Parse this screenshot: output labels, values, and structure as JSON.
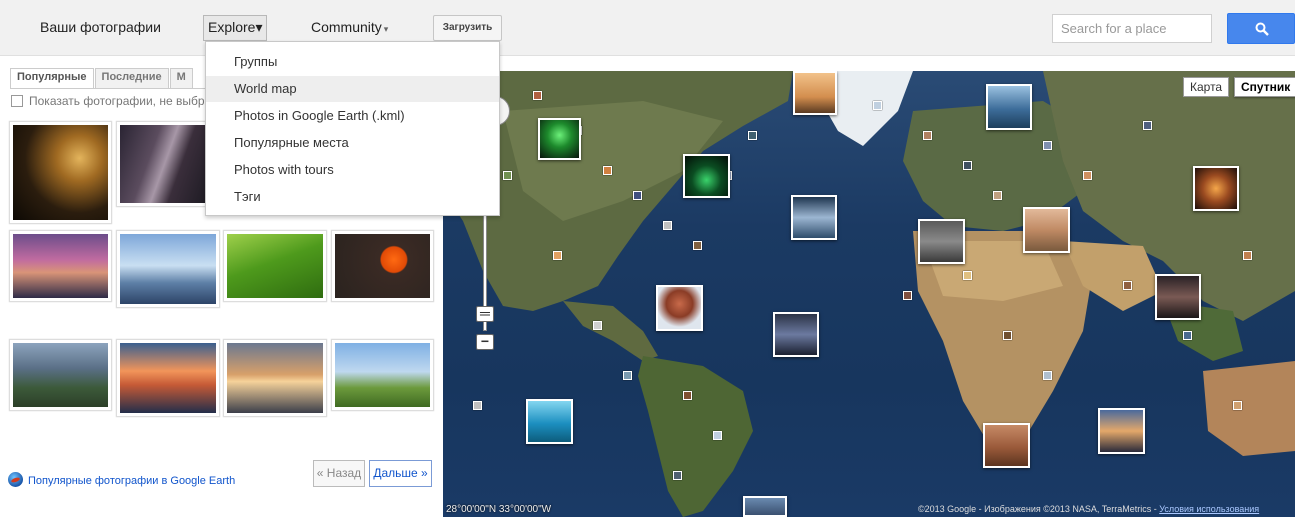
{
  "header": {
    "your_photos": "Ваши фотографии",
    "explore": "Explore",
    "community": "Community",
    "caret": "▾",
    "upload": "Загрузить",
    "search_placeholder": "Search for a place"
  },
  "explore_menu": {
    "items": [
      {
        "label": "Группы"
      },
      {
        "label": "World map",
        "highlighted": true
      },
      {
        "label": "Photos in Google Earth (.kml)"
      },
      {
        "label": "Популярные места"
      },
      {
        "label": "Photos with tours"
      },
      {
        "label": "Тэги"
      }
    ]
  },
  "left_panel": {
    "tabs": [
      {
        "label": "Популярные",
        "active": true
      },
      {
        "label": "Последние",
        "active": false
      },
      {
        "label": "М",
        "active": false
      }
    ],
    "show_unselected_label": "Показать фотографии, не выбр",
    "google_earth_link": "Популярные фотографии в Google Earth",
    "prev_button": "« Назад",
    "next_button": "Дальше »"
  },
  "map": {
    "type_map": "Карта",
    "type_satellite": "Спутник",
    "zoom_in": "+",
    "zoom_out": "−",
    "coords": "28°00'00\"N 33°00'00\"W",
    "attribution": "©2013 Google - Изображения ©2013 NASA, TerraMetrics - ",
    "terms_link": "Условия использования"
  },
  "colors": {
    "accent_blue": "#4787ed",
    "link_blue": "#1155cc",
    "topbar_bg": "#f1f1f1"
  }
}
